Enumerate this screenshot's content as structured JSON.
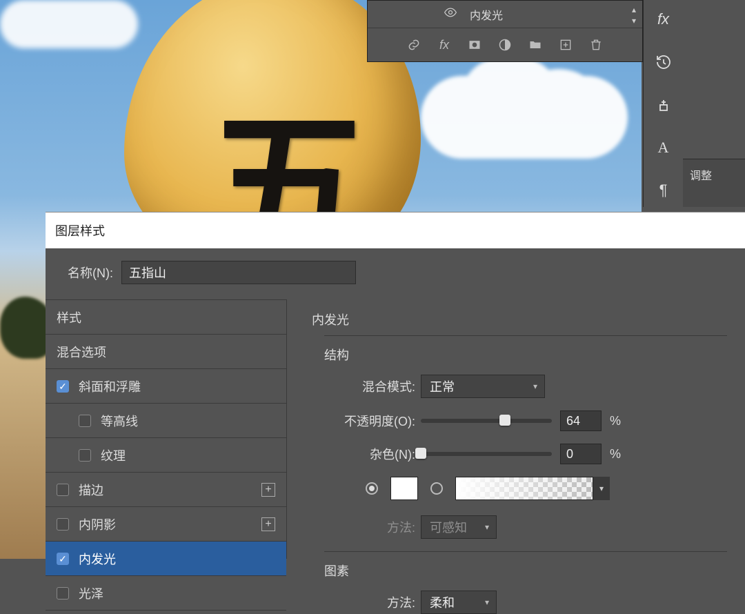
{
  "canvas": {
    "glyph": "五"
  },
  "layers_panel": {
    "effect_label": "内发光"
  },
  "right_strip": {
    "glyph_A": "A",
    "glyph_pilcrow": "¶"
  },
  "adjust_panel": {
    "title": "调整"
  },
  "dialog": {
    "title": "图层样式",
    "name_label": "名称(N):",
    "name_value": "五指山"
  },
  "fx_list": {
    "styles_header": "样式",
    "blend_options": "混合选项",
    "bevel": "斜面和浮雕",
    "contour": "等高线",
    "texture": "纹理",
    "stroke": "描边",
    "inner_shadow": "内阴影",
    "inner_glow": "内发光",
    "satin": "光泽"
  },
  "settings": {
    "section_title": "内发光",
    "structure_title": "结构",
    "blend_mode_label": "混合模式:",
    "blend_mode_value": "正常",
    "opacity_label": "不透明度(O):",
    "opacity_value": "64",
    "opacity_unit": "%",
    "opacity_pct": 64,
    "noise_label": "杂色(N):",
    "noise_value": "0",
    "noise_unit": "%",
    "noise_pct": 0,
    "method_label": "方法:",
    "method_value": "可感知",
    "elements_title": "图素",
    "elements_method_label": "方法:",
    "elements_method_value": "柔和"
  }
}
